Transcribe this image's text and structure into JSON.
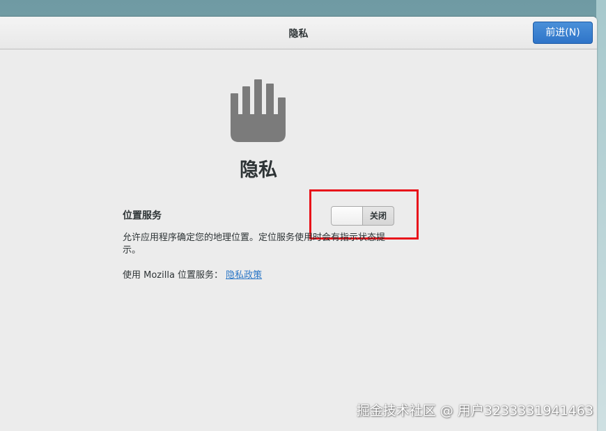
{
  "header": {
    "title": "隐私",
    "next_button": "前进(N)"
  },
  "page": {
    "icon": "hand-stop-icon",
    "title": "隐私"
  },
  "location_service": {
    "label": "位置服务",
    "toggle_state": "关闭",
    "description": "允许应用程序确定您的地理位置。定位服务使用时会有指示状态提示。",
    "mozilla_prefix": "使用  Mozilla 位置服务：",
    "privacy_link": "隐私政策"
  },
  "watermark": "掘金技术社区 @ 用户3233331941463",
  "colors": {
    "accent": "#2f74c8",
    "link": "#2a76c6",
    "highlight": "#e8121a",
    "icon": "#7b7b7b"
  }
}
